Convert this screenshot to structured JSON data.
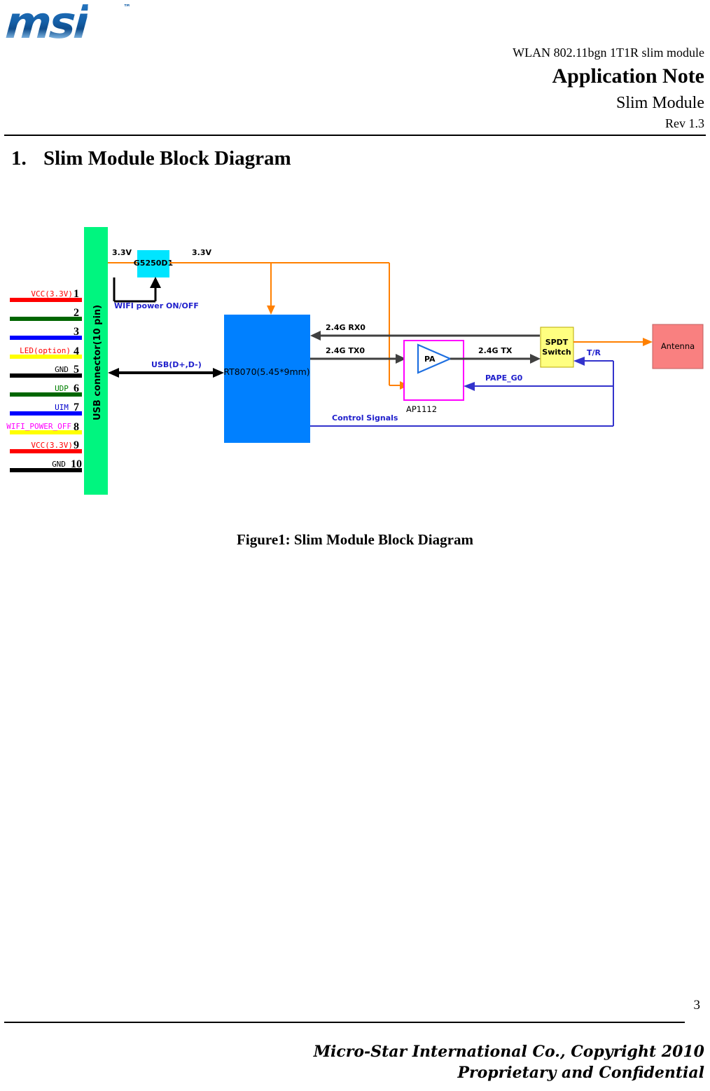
{
  "header": {
    "logo_text": "msi",
    "logo_tm": "™",
    "subject": "WLAN 802.11bgn 1T1R slim module",
    "title": "Application Note",
    "document": "Slim Module",
    "revision": "Rev 1.3"
  },
  "section": {
    "number": "1.",
    "heading": "Slim Module Block Diagram"
  },
  "figure": {
    "caption": "Figure1: Slim Module Block Diagram"
  },
  "footer": {
    "page_number": "3",
    "company": "Micro-Star International Co., Copyright 2010",
    "confidentiality": "Proprietary and Confidential"
  },
  "diagram": {
    "connector": {
      "label": "USB connector(10 pin)",
      "fill": "#00F57F",
      "pins": [
        {
          "number": "1",
          "label": "VCC(3.3V)",
          "label_color": "#FF0000",
          "wire_color": "#FF0000"
        },
        {
          "number": "2",
          "label": "",
          "label_color": "#000000",
          "wire_color": "#006600"
        },
        {
          "number": "3",
          "label": "",
          "label_color": "#000000",
          "wire_color": "#0000FF"
        },
        {
          "number": "4",
          "label": "LED(option)",
          "label_color": "#FF0000",
          "wire_color": "#FFFF00"
        },
        {
          "number": "5",
          "label": "GND",
          "label_color": "#000000",
          "wire_color": "#000000"
        },
        {
          "number": "6",
          "label": "UDP",
          "label_color": "#008000",
          "wire_color": "#006600"
        },
        {
          "number": "7",
          "label": "UIM",
          "label_color": "#0000CC",
          "wire_color": "#0000FF"
        },
        {
          "number": "8",
          "label": "WIFI_POWER_OFF",
          "label_color": "#FF00FF",
          "wire_color": "#FFFF00"
        },
        {
          "number": "9",
          "label": "VCC(3.3V)",
          "label_color": "#FF0000",
          "wire_color": "#FF0000"
        },
        {
          "number": "10",
          "label": "GND",
          "label_color": "#000000",
          "wire_color": "#000000"
        }
      ]
    },
    "blocks": [
      {
        "id": "ldo",
        "label": "G5250D1",
        "fill": "#00E5FF",
        "stroke": "none"
      },
      {
        "id": "soc",
        "label": "RT8070(5.45*9mm)",
        "fill": "#0080FF",
        "stroke": "none"
      },
      {
        "id": "pa",
        "label": "AP1112",
        "inner_label": "PA",
        "fill": "#FFFFFF",
        "stroke": "#FF00FF"
      },
      {
        "id": "spdt",
        "label": "SPDT\nSwitch",
        "fill": "#FFFF80",
        "stroke": "#000000"
      },
      {
        "id": "antenna",
        "label": "Antenna",
        "fill": "#F98080",
        "stroke": "#000000"
      }
    ],
    "block_labels": {
      "ldo": "G5250D1",
      "soc": "RT8070(5.45*9mm)",
      "pa_inner": "PA",
      "pa_outer": "AP1112",
      "spdt_line1": "SPDT",
      "spdt_line2": "Switch",
      "antenna": "Antenna"
    },
    "net_labels": {
      "vin_3v3": "3.3V",
      "vout_3v3": "3.3V",
      "wifi_power": "WIFI power ON/OFF",
      "usb": "USB(D+,D-)",
      "rx0": "2.4G RX0",
      "tx0": "2.4G TX0",
      "tx": "2.4G TX",
      "pape": "PAPE_G0",
      "tr": "T/R",
      "control": "Control Signals"
    },
    "colors": {
      "power_net": "#FF8000",
      "rf_net": "#404040",
      "control_net": "#3333CC",
      "label_blue": "#2020CC"
    }
  }
}
